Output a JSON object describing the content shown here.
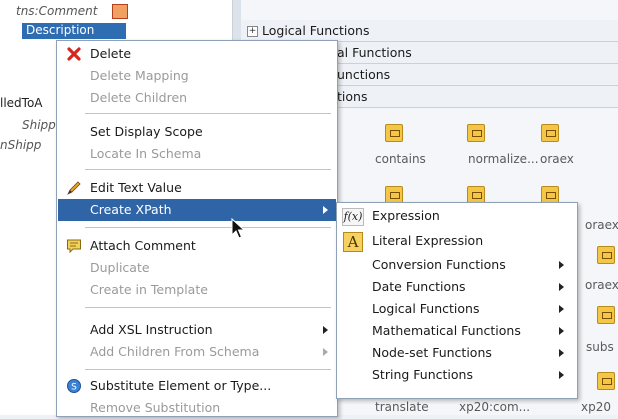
{
  "tree": {
    "rows": [
      {
        "text": "tns:Comment",
        "selected": false
      },
      {
        "text": "Description",
        "selected": true
      },
      {
        "text": "lledToA",
        "selected": false
      },
      {
        "text": "Shipp",
        "selected": false
      },
      {
        "text": "nShipp",
        "selected": false
      }
    ]
  },
  "palette": {
    "sections": [
      "Logical Functions",
      "al Functions",
      "unctions",
      "tions"
    ],
    "items_row1": [
      "contains",
      "normalize...",
      "oraex"
    ],
    "items_row2": [
      "oraex"
    ],
    "items_row3": [
      "oraex"
    ],
    "items_row4": [
      "subs"
    ],
    "items_last": [
      "translate",
      "xp20:com...",
      "xp20"
    ]
  },
  "context_menu": {
    "items": [
      {
        "label": "Delete",
        "enabled": true,
        "icon": "delete-x-icon"
      },
      {
        "label": "Delete Mapping",
        "enabled": false
      },
      {
        "label": "Delete Children",
        "enabled": false
      },
      {
        "label": "Set Display Scope",
        "enabled": true
      },
      {
        "label": "Locate In Schema",
        "enabled": false
      },
      {
        "label": "Edit Text Value",
        "enabled": true,
        "icon": "pencil-icon"
      },
      {
        "label": "Create XPath",
        "enabled": true,
        "highlighted": true,
        "submenu": true
      },
      {
        "label": "Attach Comment",
        "enabled": true,
        "icon": "comment-icon"
      },
      {
        "label": "Duplicate",
        "enabled": false
      },
      {
        "label": "Create in Template",
        "enabled": false
      },
      {
        "label": "Add XSL Instruction",
        "enabled": true,
        "submenu": true
      },
      {
        "label": "Add Children From Schema",
        "enabled": false,
        "submenu": true
      },
      {
        "label": "Substitute Element or Type...",
        "enabled": true,
        "icon": "substitute-icon"
      },
      {
        "label": "Remove Substitution",
        "enabled": false
      }
    ]
  },
  "submenu": {
    "items": [
      {
        "label": "Expression",
        "icon": "fx-icon",
        "icon_text": "f(x)"
      },
      {
        "label": "Literal Expression",
        "icon": "literal-a-icon",
        "icon_text": "A"
      },
      {
        "label": "Conversion Functions",
        "submenu": true
      },
      {
        "label": "Date Functions",
        "submenu": true
      },
      {
        "label": "Logical Functions",
        "submenu": true
      },
      {
        "label": "Mathematical Functions",
        "submenu": true
      },
      {
        "label": "Node-set Functions",
        "submenu": true
      },
      {
        "label": "String Functions",
        "submenu": true
      }
    ]
  },
  "colors": {
    "highlight": "#2f65a7",
    "selection": "#2f6db2",
    "disabled_text": "#9a9a9a"
  }
}
